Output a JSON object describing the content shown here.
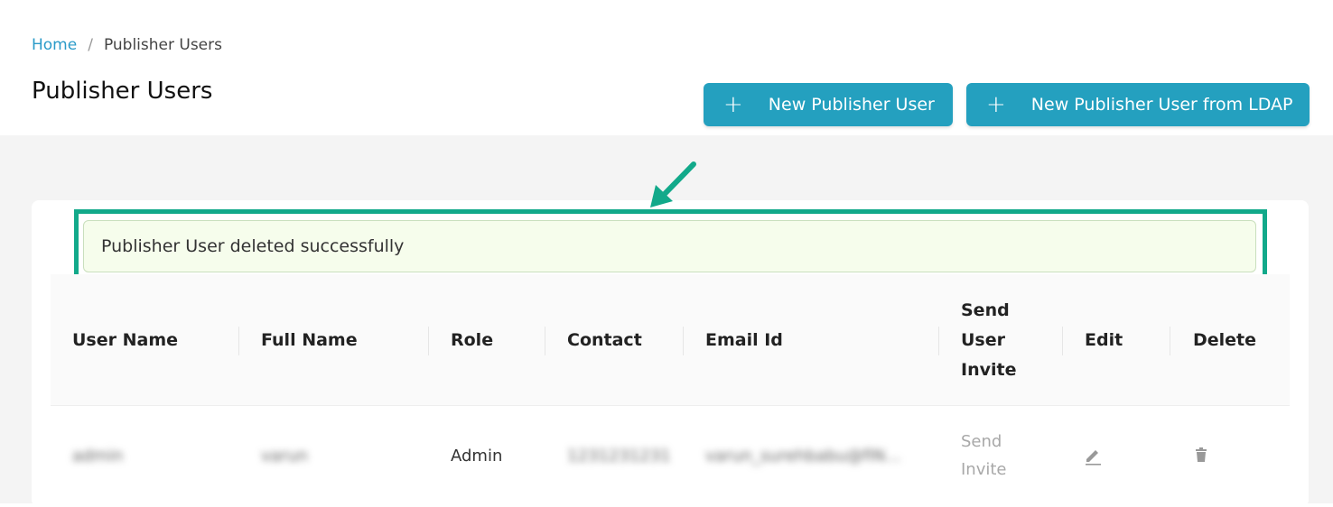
{
  "breadcrumb": {
    "home": "Home",
    "separator": "/",
    "current": "Publisher Users"
  },
  "page": {
    "title": "Publisher Users"
  },
  "actions": {
    "new_user": {
      "icon": "+",
      "label": "New Publisher User"
    },
    "new_user_ldap": {
      "icon": "+",
      "label": "New Publisher User from LDAP"
    }
  },
  "alert": {
    "message": "Publisher User deleted successfully"
  },
  "table": {
    "headers": {
      "user_name": "User Name",
      "full_name": "Full Name",
      "role": "Role",
      "contact": "Contact",
      "email": "Email Id",
      "send_invite": "Send User Invite",
      "edit": "Edit",
      "delete": "Delete"
    },
    "rows": [
      {
        "user_name": "admin",
        "full_name": "varun",
        "role": "Admin",
        "contact": "1231231231",
        "email": "varun_surehbabu@fiN...",
        "send_invite": "Send Invite"
      }
    ]
  },
  "colors": {
    "primary": "#24a0bf",
    "highlight": "#12a98a",
    "link": "#2b9bc9",
    "alert_bg": "#f6fdec"
  }
}
